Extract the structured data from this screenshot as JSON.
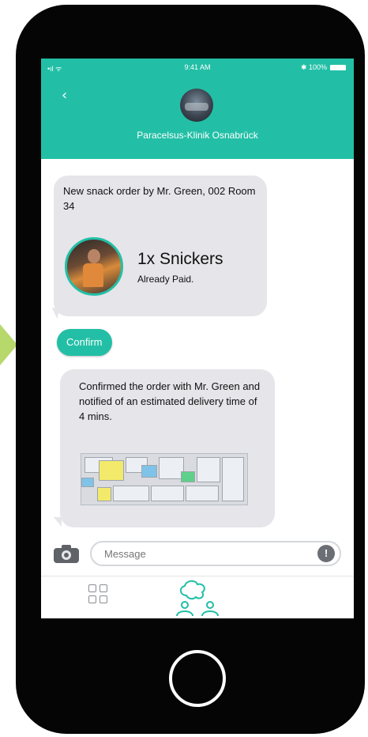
{
  "status": {
    "signal": "•ıl ᯤ",
    "time": "9:41 AM",
    "battery": "✱ 100%"
  },
  "header": {
    "back_icon": "‹",
    "title": "Paracelsus-Klinik Osnabrück"
  },
  "chat": {
    "order_message": "New snack order by Mr. Green, 002 Room 34",
    "product_name": "1x Snickers",
    "product_status": "Already Paid.",
    "confirm_label": "Confirm",
    "confirmation_message": "Confirmed the order with Mr. Green and notified of an estimated delivery time of 4 mins."
  },
  "composer": {
    "placeholder": "Message",
    "mic_icon": "!"
  },
  "colors": {
    "accent": "#22bfa6",
    "bubble": "#e5e5ea",
    "phone_frame": "#050505",
    "arrow": "#b7d86b"
  },
  "icons": {
    "camera": "camera-icon",
    "mic": "microphone-icon",
    "grid": "grid-icon",
    "people": "people-chat-icon"
  }
}
